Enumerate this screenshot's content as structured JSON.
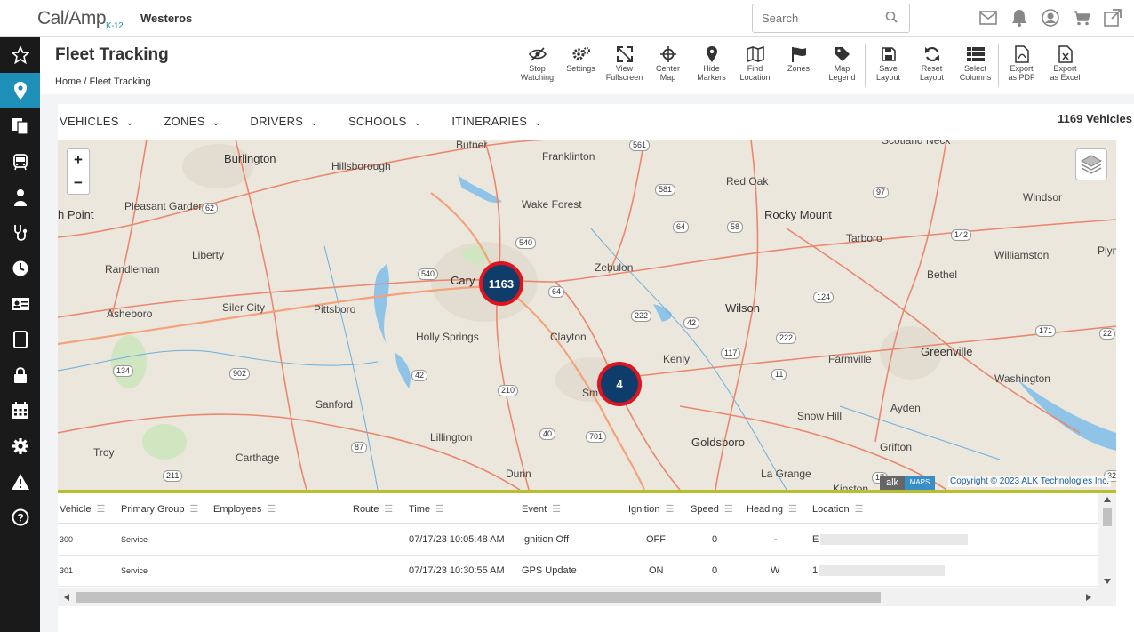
{
  "app": {
    "logo": "Cal/Amp",
    "logo_sub": "K-12",
    "org": "Westeros"
  },
  "search": {
    "placeholder": "Search"
  },
  "top_icons": [
    "mail-icon",
    "bell-icon",
    "user-icon",
    "cart-icon",
    "external-link-icon"
  ],
  "sidebar": {
    "items": [
      "star-icon",
      "location-pin-icon",
      "documents-icon",
      "bus-icon",
      "driver-icon",
      "stethoscope-icon",
      "clock-icon",
      "id-card-icon",
      "tablet-icon",
      "lock-icon",
      "calendar-icon",
      "gear-icon",
      "warning-icon",
      "help-icon"
    ],
    "active_index": 1
  },
  "page": {
    "title": "Fleet Tracking",
    "breadcrumb_home": "Home",
    "breadcrumb_sep": "/",
    "breadcrumb_current": "Fleet Tracking"
  },
  "toolbar": {
    "group1": [
      {
        "label1": "Stop",
        "label2": "Watching",
        "icon": "eye-slash-icon"
      },
      {
        "label1": "Settings",
        "label2": "",
        "icon": "gears-icon"
      },
      {
        "label1": "View",
        "label2": "Fullscreen",
        "icon": "expand-icon"
      },
      {
        "label1": "Center",
        "label2": "Map",
        "icon": "crosshair-icon"
      },
      {
        "label1": "Hide",
        "label2": "Markers",
        "icon": "map-marker-icon"
      },
      {
        "label1": "Find",
        "label2": "Location",
        "icon": "map-icon"
      },
      {
        "label1": "Zones",
        "label2": "",
        "icon": "flag-icon"
      },
      {
        "label1": "Map",
        "label2": "Legend",
        "icon": "tag-icon"
      }
    ],
    "group2": [
      {
        "label1": "Save",
        "label2": "Layout",
        "icon": "save-icon"
      },
      {
        "label1": "Reset",
        "label2": "Layout",
        "icon": "refresh-icon"
      },
      {
        "label1": "Select",
        "label2": "Columns",
        "icon": "columns-icon"
      }
    ],
    "group3": [
      {
        "label1": "Export",
        "label2": "as PDF",
        "icon": "pdf-icon"
      },
      {
        "label1": "Export",
        "label2": "as Excel",
        "icon": "excel-icon"
      }
    ]
  },
  "filters": [
    "VEHICLES",
    "ZONES",
    "DRIVERS",
    "SCHOOLS",
    "ITINERARIES"
  ],
  "vehicle_count": "1169 Vehicles",
  "map": {
    "zoom_in": "+",
    "zoom_out": "−",
    "clusters": [
      {
        "count": "1163"
      },
      {
        "count": "4"
      }
    ],
    "copyright": "Copyright © 2023 ALK Technologies Inc.",
    "alk_logo": "alk",
    "alk_maps": "MAPS",
    "places": [
      "Burlington",
      "Hillsborough",
      "Butner",
      "Franklinton",
      "Scotland Neck",
      "Red Oak",
      "Windsor",
      "Wake Forest",
      "Rocky Mount",
      "Tarboro",
      "Pleasant Garden",
      "Randleman",
      "Liberty",
      "Asheboro",
      "Siler City",
      "Pittsboro",
      "Cary",
      "Zebulon",
      "Williamston",
      "Bethel",
      "Wilson",
      "Clayton",
      "Holly Springs",
      "Greenville",
      "Farmville",
      "Kenly",
      "Washington",
      "Sanford",
      "Snow Hill",
      "Ayden",
      "Lillington",
      "Goldsboro",
      "Grifton",
      "Troy",
      "Carthage",
      "Dunn",
      "La Grange",
      "h Point",
      "Plym",
      "Sm",
      "on",
      "Kinston"
    ],
    "shields": [
      "561",
      "62",
      "581",
      "97",
      "540",
      "64",
      "58",
      "142",
      "540",
      "64",
      "222",
      "42",
      "124",
      "171",
      "22",
      "117",
      "222",
      "902",
      "42",
      "11",
      "134",
      "210",
      "701",
      "87",
      "40",
      "211",
      "17",
      "32"
    ]
  },
  "grid": {
    "columns": [
      "Vehicle",
      "Primary Group",
      "Employees",
      "Route",
      "Time",
      "Event",
      "Ignition",
      "Speed",
      "Heading",
      "Location"
    ],
    "rows": [
      {
        "vehicle": "300",
        "group": "Service",
        "employees": "",
        "route": "",
        "time": "07/17/23 10:05:48 AM",
        "event": "Ignition Off",
        "ignition": "OFF",
        "speed": "0",
        "heading": "-",
        "location": "E"
      },
      {
        "vehicle": "301",
        "group": "Service",
        "employees": "",
        "route": "",
        "time": "07/17/23 10:30:55 AM",
        "event": "GPS Update",
        "ignition": "ON",
        "speed": "0",
        "heading": "W",
        "location": "1"
      }
    ]
  },
  "colors": {
    "accent": "#1e90b8",
    "cluster_fill": "#0f3d6b",
    "cluster_ring": "#e0141e",
    "divider": "#b7bf2e"
  }
}
